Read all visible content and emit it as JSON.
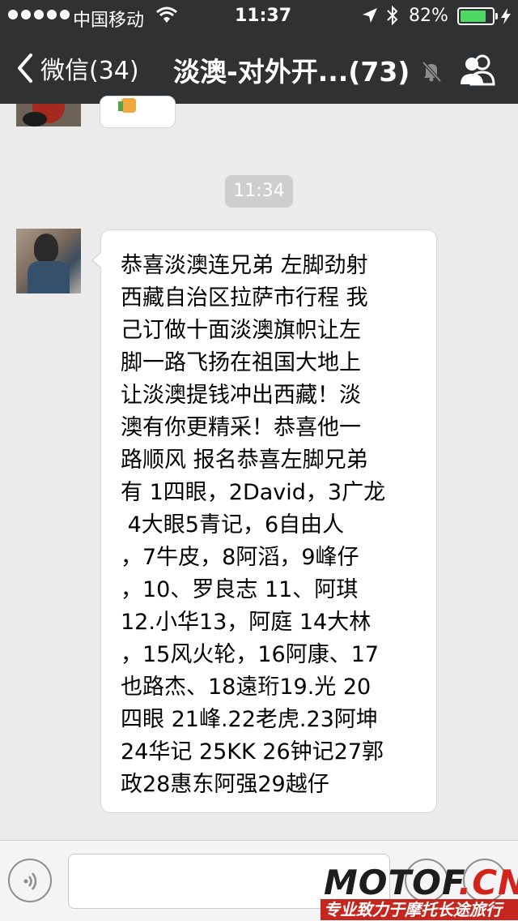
{
  "status_bar": {
    "carrier": "中国移动",
    "time": "11:37",
    "battery_pct": "82%",
    "battery_level": 0.82
  },
  "nav": {
    "back_label": "微信(34)",
    "title": "淡澳-对外开...(73)"
  },
  "chat": {
    "timestamp": "11:34",
    "message": "恭喜淡澳连兄弟 左脚劲射\n西藏自治区拉萨市行程 我\n己订做十面淡澳旗帜让左\n脚一路飞扬在祖国大地上\n让淡澳提钱冲出西藏！淡\n澳有你更精采！恭喜他一\n路顺风 报名恭喜左脚兄弟\n有 1四眼，2David，3广龙\n 4大眼5青记，6自由人\n，7牛皮，8阿滔，9峰仔\n，10、罗良志 11、阿琪\n12.小华13，阿庭 14大林\n，15风火轮，16阿康、17\n也路杰、18遠珩19.光 20\n四眼 21峰.22老虎.23阿坤\n24华记 25KK 26钟记27郭\n政28惠东阿强29越仔"
  },
  "input": {
    "placeholder": ""
  },
  "watermark": {
    "logo_main": "MOTOF",
    "logo_suffix": ".CN",
    "tagline": "专业致力于摩托长途旅行"
  },
  "colors": {
    "nav_bg": "#2f3133",
    "chat_bg": "#ebebeb",
    "battery_green": "#4cd964",
    "watermark_red": "#c5271f"
  },
  "icons": [
    "signal-dots-icon",
    "wifi-icon",
    "location-arrow-icon",
    "bluetooth-icon",
    "battery-icon",
    "charging-bolt-icon",
    "back-chevron-icon",
    "muted-bell-icon",
    "group-members-icon",
    "voice-icon",
    "emoji-icon",
    "plus-icon"
  ]
}
